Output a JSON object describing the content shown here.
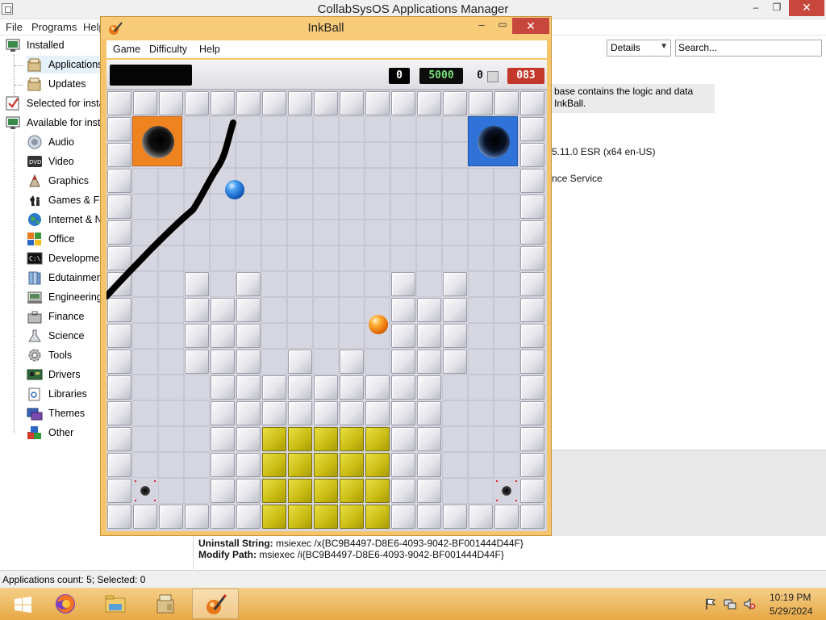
{
  "main_window": {
    "title": "CollabSysOS Applications Manager",
    "menu": [
      "File",
      "Programs",
      "Help"
    ],
    "caption": {
      "minimize": "–",
      "maximize": "❐",
      "close": "✕"
    }
  },
  "tree": [
    {
      "label": "Installed",
      "icon": "monitor-icon"
    },
    {
      "label": "Applications",
      "icon": "package-icon"
    },
    {
      "label": "Updates",
      "icon": "package-icon"
    },
    {
      "label": "Selected for installation",
      "icon": "checklist-icon"
    },
    {
      "label": "Available for installation",
      "icon": "monitor-icon"
    },
    {
      "label": "Audio",
      "icon": "speaker-icon"
    },
    {
      "label": "Video",
      "icon": "dvd-icon"
    },
    {
      "label": "Graphics",
      "icon": "graphics-icon"
    },
    {
      "label": "Games & Fun",
      "icon": "chess-icon"
    },
    {
      "label": "Internet & Network",
      "icon": "globe-icon"
    },
    {
      "label": "Office",
      "icon": "office-icon"
    },
    {
      "label": "Development",
      "icon": "terminal-icon"
    },
    {
      "label": "Edutainment",
      "icon": "books-icon"
    },
    {
      "label": "Engineering",
      "icon": "engineering-icon"
    },
    {
      "label": "Finance",
      "icon": "briefcase-icon"
    },
    {
      "label": "Science",
      "icon": "science-icon"
    },
    {
      "label": "Tools",
      "icon": "gear-icon"
    },
    {
      "label": "Drivers",
      "icon": "board-icon"
    },
    {
      "label": "Libraries",
      "icon": "library-icon"
    },
    {
      "label": "Themes",
      "icon": "themes-icon"
    },
    {
      "label": "Other",
      "icon": "shapes-icon"
    }
  ],
  "right": {
    "view_select": "Details",
    "search_value": "Search...",
    "description_line1": "base contains the logic and data",
    "description_line2": "InkBall.",
    "version_text": "5.11.0 ESR (x64 en-US)",
    "service_text": "nce Service"
  },
  "bottom": {
    "uninstall_label": "Uninstall String:",
    "uninstall_value": "msiexec /x{BC9B4497-D8E6-4093-9042-BF001444D44F}",
    "modify_label": "Modify Path:",
    "modify_value": "msiexec /i{BC9B4497-D8E6-4093-9042-BF001444D44F}"
  },
  "status": "Applications count: 5; Selected: 0",
  "taskbar": {
    "apps": [
      "firefox-icon",
      "file-explorer-icon",
      "package-manager-icon",
      "inkball-icon"
    ],
    "time": "10:19 PM",
    "date": "5/29/2024"
  },
  "inkball": {
    "title": "InkBall",
    "menu": [
      "Game",
      "Difficulty",
      "Help"
    ],
    "caption": {
      "minimize": "–",
      "maximize": "▭",
      "close": "✕"
    },
    "score_left": "0",
    "score_target": "5000",
    "balls_lost": "0",
    "time_remaining": "083",
    "colors": {
      "hole_orange": "#ef8320",
      "hole_blue": "#2f73d8",
      "ball_orange": "#f08a10",
      "ball_blue": "#1a6bd0",
      "yellow_block": "#d8cb1e",
      "ink": "#000000"
    }
  }
}
